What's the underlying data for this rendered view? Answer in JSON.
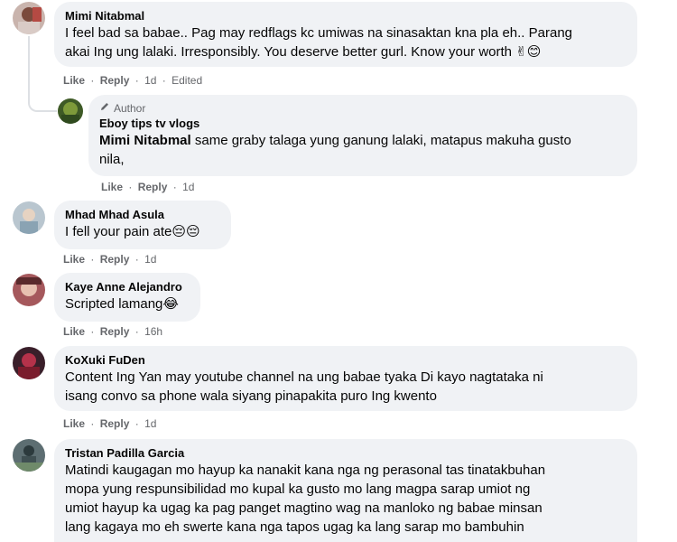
{
  "comments": [
    {
      "name": "Mimi Nitabmal",
      "lines": [
        "I feel bad sa babae.. Pag may redflags kc umiwas na sinasaktan kna pla eh.. Parang",
        "akai Ing ung lalaki. Irresponsibly. You deserve better gurl. Know your worth ✌😊"
      ],
      "like": "Like",
      "reply": "Reply",
      "time": "1d",
      "edited": "Edited"
    },
    {
      "badge": "Author",
      "name": "Eboy tips tv vlogs",
      "mention": "Mimi Nitabmal",
      "line1_rest": " same graby talaga yung ganung lalaki, matapus makuha gusto",
      "line2": "nila,",
      "like": "Like",
      "reply": "Reply",
      "time": "1d"
    },
    {
      "name": "Mhad Mhad Asula",
      "lines": [
        "I fell your pain ate😔😔"
      ],
      "like": "Like",
      "reply": "Reply",
      "time": "1d"
    },
    {
      "name": "Kaye Anne Alejandro",
      "lines": [
        "Scripted lamang😂"
      ],
      "like": "Like",
      "reply": "Reply",
      "time": "16h"
    },
    {
      "name": "KoXuki FuDen",
      "lines": [
        "Content Ing Yan may youtube channel na ung babae tyaka Di kayo nagtataka ni",
        "isang convo sa phone wala siyang pinapakita puro Ing kwento"
      ],
      "like": "Like",
      "reply": "Reply",
      "time": "1d"
    },
    {
      "name": "Tristan Padilla Garcia",
      "lines": [
        "Matindi kaugagan mo hayup ka nanakit kana nga ng perasonal tas tinatakbuhan",
        "mopa yung respunsibilidad mo kupal ka gusto mo lang magpa sarap umiot ng",
        "umiot hayup ka ugag ka pag panget magtino wag na manloko ng babae minsan",
        "lang kagaya mo eh swerte kana nga tapos ugag ka lang sarap mo bambuhin"
      ]
    }
  ],
  "colors": {
    "bubble": "#f0f2f5",
    "meta": "#65676b",
    "text": "#050505"
  },
  "icons": {
    "author": "pencil-icon"
  }
}
